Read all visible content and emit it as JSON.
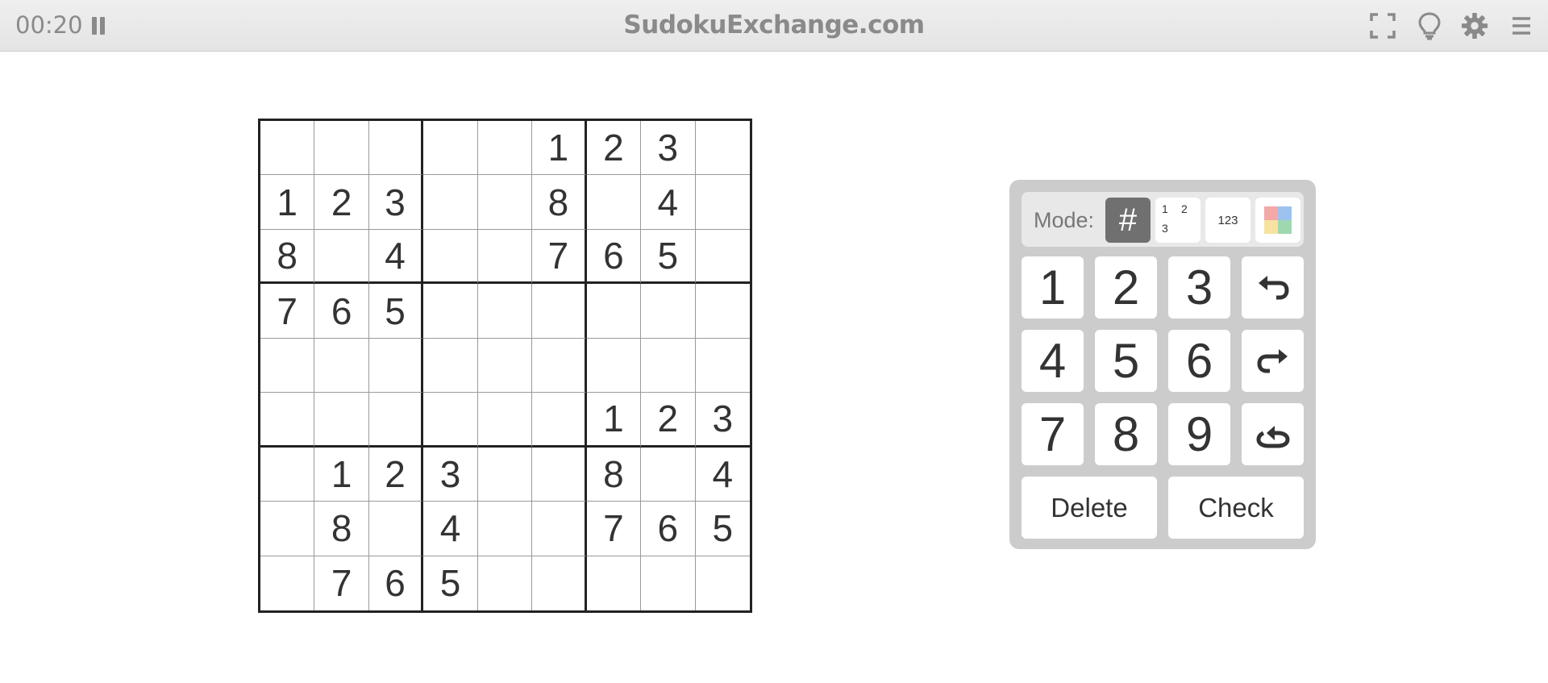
{
  "header": {
    "timer": "00:20",
    "title": "SudokuExchange.com",
    "icons": [
      "pause-icon",
      "fullscreen-icon",
      "lightbulb-icon",
      "gear-icon",
      "hamburger-menu-icon"
    ]
  },
  "grid": {
    "rows": [
      [
        "",
        "",
        "",
        "",
        "",
        "1",
        "2",
        "3",
        ""
      ],
      [
        "1",
        "2",
        "3",
        "",
        "",
        "8",
        "",
        "4",
        ""
      ],
      [
        "8",
        "",
        "4",
        "",
        "",
        "7",
        "6",
        "5",
        ""
      ],
      [
        "7",
        "6",
        "5",
        "",
        "",
        "",
        "",
        "",
        ""
      ],
      [
        "",
        "",
        "",
        "",
        "",
        "",
        "",
        "",
        ""
      ],
      [
        "",
        "",
        "",
        "",
        "",
        "",
        "1",
        "2",
        "3"
      ],
      [
        "",
        "1",
        "2",
        "3",
        "",
        "",
        "8",
        "",
        "4"
      ],
      [
        "",
        "8",
        "",
        "4",
        "",
        "",
        "7",
        "6",
        "5"
      ],
      [
        "",
        "7",
        "6",
        "5",
        "",
        "",
        "",
        "",
        ""
      ]
    ]
  },
  "panel": {
    "mode_label": "Mode:",
    "modes": {
      "normal": "#",
      "pencil": [
        "1",
        "2",
        "3"
      ],
      "center": "123",
      "color": [
        "#f4a8a8",
        "#9cc3ef",
        "#f7e3a1",
        "#9ed8b0"
      ]
    },
    "keys": [
      "1",
      "2",
      "3",
      "4",
      "5",
      "6",
      "7",
      "8",
      "9"
    ],
    "action_icons": [
      "undo-icon",
      "redo-icon",
      "restart-icon"
    ],
    "delete_label": "Delete",
    "check_label": "Check"
  }
}
